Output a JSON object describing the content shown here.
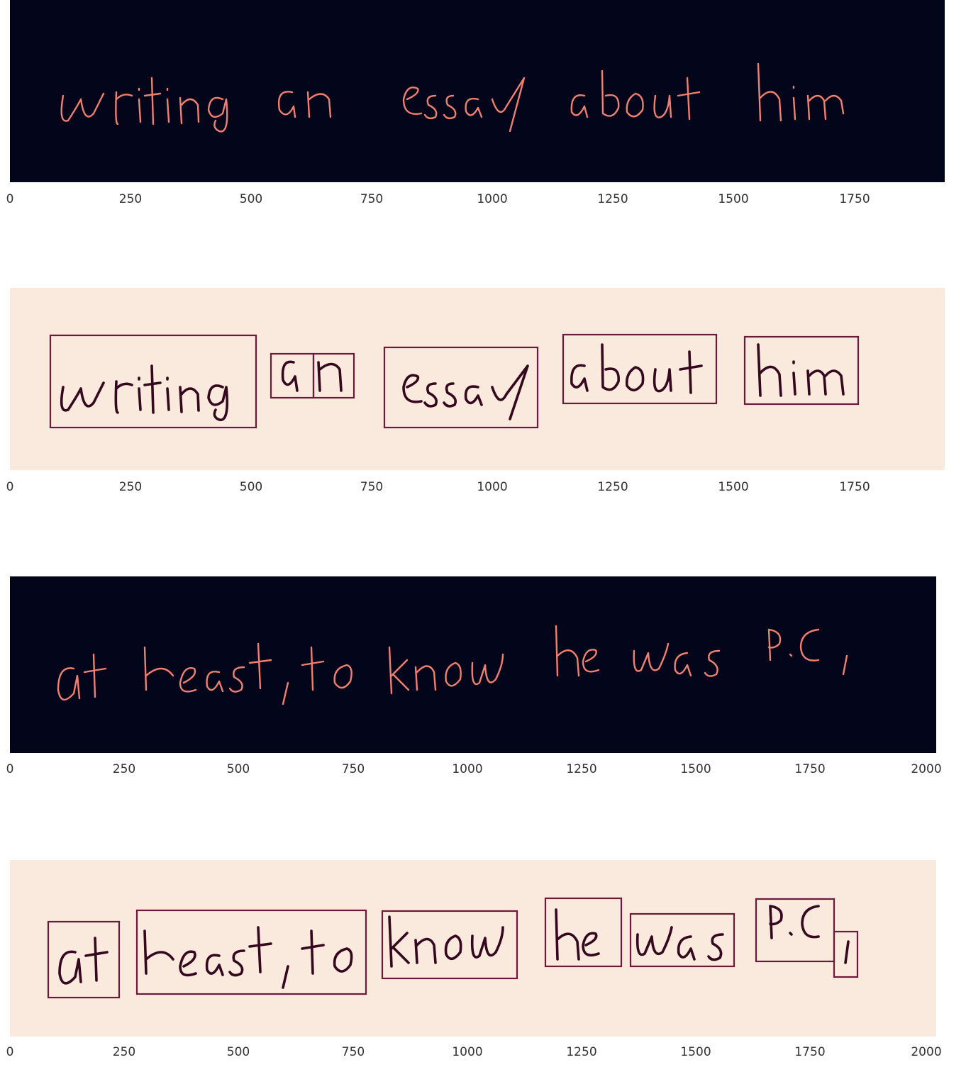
{
  "chart_data": [
    {
      "type": "image",
      "colormap": "dark",
      "background": "#03051a",
      "ink": "#f08070",
      "transcription_words": [
        "writing",
        "an",
        "essay",
        "about",
        "him"
      ],
      "xlim": [
        0,
        1943
      ],
      "xticks": [
        0,
        250,
        500,
        750,
        1000,
        1250,
        1500,
        1750
      ],
      "boxes": []
    },
    {
      "type": "image",
      "colormap": "light",
      "background": "#faeade",
      "ink": "#35081f",
      "transcription_words": [
        "writing",
        "an",
        "essay",
        "about",
        "him"
      ],
      "xlim": [
        0,
        1943
      ],
      "xticks": [
        0,
        250,
        500,
        750,
        1000,
        1250,
        1500,
        1750
      ],
      "boxes": [
        {
          "x0": 85,
          "x1": 510
        },
        {
          "x0": 542,
          "x1": 632
        },
        {
          "x0": 632,
          "x1": 712
        },
        {
          "x0": 780,
          "x1": 1097
        },
        {
          "x0": 1153,
          "x1": 1472
        },
        {
          "x0": 1530,
          "x1": 1768
        }
      ]
    },
    {
      "type": "image",
      "colormap": "dark",
      "background": "#03051a",
      "ink": "#f08070",
      "transcription_words": [
        "at",
        "least,",
        "to",
        "know",
        "he",
        "was",
        "P.C,"
      ],
      "xlim": [
        0,
        2020
      ],
      "xticks": [
        0,
        250,
        500,
        750,
        1000,
        1250,
        1500,
        1750,
        2000
      ],
      "boxes": []
    },
    {
      "type": "image",
      "colormap": "light",
      "background": "#faeade",
      "ink": "#35081f",
      "transcription_words": [
        "at",
        "least,",
        "to",
        "know",
        "he",
        "was",
        "P.C,"
      ],
      "xlim": [
        0,
        2020
      ],
      "xticks": [
        0,
        250,
        500,
        750,
        1000,
        1250,
        1500,
        1750,
        2000
      ],
      "boxes": [
        {
          "x0": 85,
          "x1": 240
        },
        {
          "x0": 277,
          "x1": 778
        },
        {
          "x0": 812,
          "x1": 1106
        },
        {
          "x0": 1170,
          "x1": 1335
        },
        {
          "x0": 1353,
          "x1": 1580
        },
        {
          "x0": 1628,
          "x1": 1800
        },
        {
          "x0": 1800,
          "x1": 1850
        }
      ]
    }
  ]
}
